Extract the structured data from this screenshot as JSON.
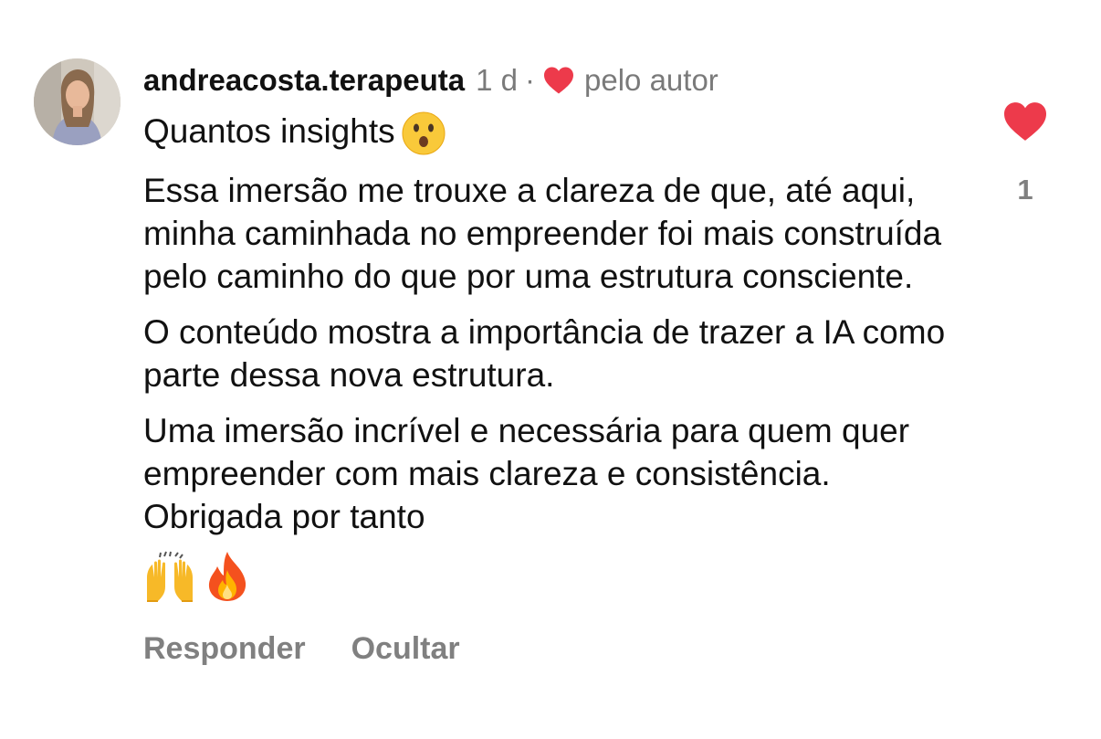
{
  "comment": {
    "avatar_icon": "profile-photo",
    "username": "andreacosta.terapeuta",
    "time": "1 d",
    "separator": "·",
    "liked_by_author_label": "pelo autor",
    "heart_color": "#ed3a4b",
    "paragraphs": [
      "Quantos insights",
      "Essa imersão me trouxe a clareza de que, até aqui, minha caminhada no empreender foi mais construída pelo caminho do que por uma estrutura consciente.",
      "O conteúdo mostra a importância de trazer a IA como parte dessa nova estrutura.",
      "Uma imersão incrível e necessária para quem quer empreender com mais clareza e consistência. Obrigada por tanto"
    ],
    "first_line_emoji": "astonished-face-icon",
    "trailing_emojis": [
      "raising-hands-icon",
      "fire-icon"
    ],
    "actions": {
      "reply": "Responder",
      "hide": "Ocultar"
    },
    "like_count": "1"
  }
}
